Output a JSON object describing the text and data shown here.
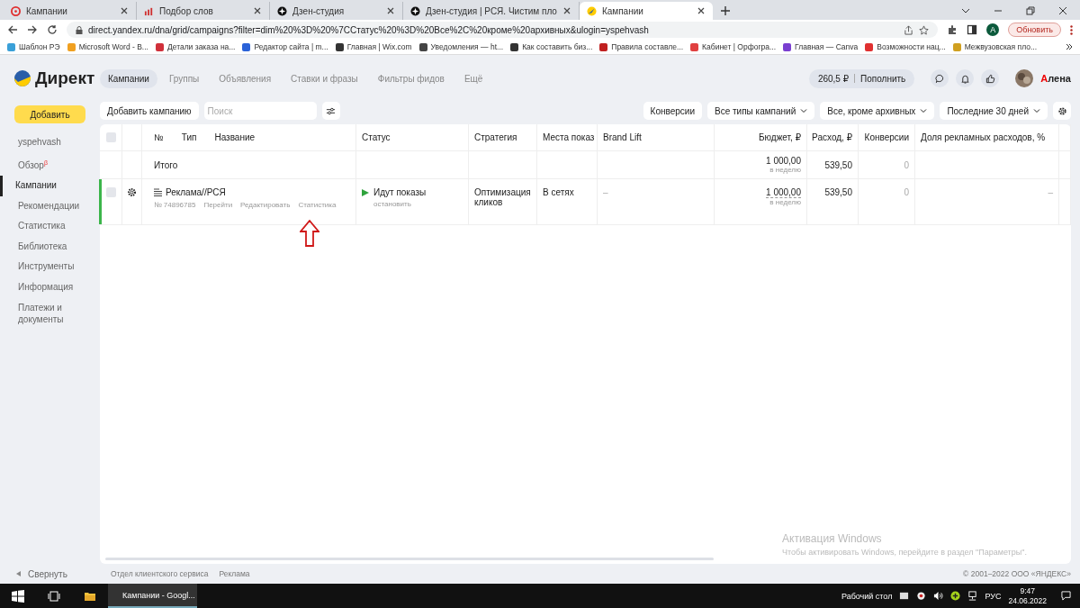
{
  "browser": {
    "tabs": [
      {
        "title": "Кампании",
        "selected": false
      },
      {
        "title": "Подбор слов",
        "selected": false
      },
      {
        "title": "Дзен-студия",
        "selected": false
      },
      {
        "title": "Дзен-студия | РСЯ. Чистим пло",
        "selected": false
      },
      {
        "title": "Кампании",
        "selected": true
      }
    ],
    "address": "direct.yandex.ru/dna/grid/campaigns?filter=dim%20%3D%20%7CСтатус%20%3D%20Все%2C%20кроме%20архивных&ulogin=yspehvash",
    "profile": "A",
    "update_button": "Обновить",
    "bookmarks": [
      "Шаблон РЭ",
      "Microsoft Word - В...",
      "Детали заказа на...",
      "Редактор сайта | m...",
      "Главная | Wix.com",
      "Уведомления — ht...",
      "Как составить биз...",
      "Правила составле...",
      "Кабинет | Орфогра...",
      "Главная — Canva",
      "Возможности нац...",
      "Межвузовская пло..."
    ]
  },
  "header": {
    "logo": "Директ",
    "nav": [
      {
        "label": "Кампании",
        "selected": true
      },
      {
        "label": "Группы",
        "selected": false
      },
      {
        "label": "Объявления",
        "selected": false
      },
      {
        "label": "Ставки и фразы",
        "selected": false
      },
      {
        "label": "Фильтры фидов",
        "selected": false
      },
      {
        "label": "Ещё",
        "selected": false
      }
    ],
    "balance": "260,5 ₽",
    "topup": "Пополнить",
    "user": "Алена"
  },
  "sidebar": {
    "add_button": "Добавить",
    "items": [
      {
        "label": "yspehvash",
        "selected": false
      },
      {
        "label": "Обзор$^{β}$",
        "selected": false
      },
      {
        "label": "Кампании",
        "selected": true
      },
      {
        "label": "Рекомендации",
        "selected": false
      },
      {
        "label": "Статистика",
        "selected": false
      },
      {
        "label": "Библиотека",
        "selected": false
      },
      {
        "label": "Инструменты",
        "selected": false
      },
      {
        "label": "Информация",
        "selected": false
      },
      {
        "label": "Платежи и документы",
        "selected": false
      }
    ],
    "collapse": "Свернуть"
  },
  "toolbar": {
    "add_campaign": "Добавить кампанию",
    "search": {
      "placeholder": "Поиск"
    },
    "filters": [
      {
        "label": "Конверсии",
        "dropdown": false
      },
      {
        "label": "Все типы кампаний",
        "dropdown": true
      },
      {
        "label": "Все, кроме архивных",
        "dropdown": true
      },
      {
        "label": "Последние 30 дней",
        "dropdown": true
      }
    ]
  },
  "table": {
    "all_checked": false,
    "columns": [
      "№",
      "Тип",
      "Название",
      "Статус",
      "Стратегия",
      "Места показ",
      "Brand Lift",
      "Бюджет, ₽",
      "Расход, ₽",
      "Конверсии",
      "Доля рекламных расходов, %"
    ],
    "total": {
      "label": "Итого",
      "budget": "1 000,00",
      "budget_period": "в неделю",
      "expense": "539,50",
      "conversions": "0"
    },
    "rows": [
      {
        "checked": false,
        "active": true,
        "name": "Реклама//РСЯ",
        "number": "№ 74896785",
        "actions": [
          "Перейти",
          "Редактировать",
          "Статистика"
        ],
        "status": "Идут показы",
        "status_action": "остановить",
        "strategy": "Оптимизация кликов",
        "places": "В сетях",
        "brand_lift": "–",
        "budget": "1 000,00",
        "budget_period": "в неделю",
        "expense": "539,50",
        "conversions": "0",
        "share": "–"
      }
    ]
  },
  "activation": {
    "title": "Активация Windows",
    "text": "Чтобы активировать Windows, перейдите в раздел \"Параметры\"."
  },
  "footer": {
    "links": [
      "Отдел клиентского сервиса",
      "Реклама"
    ],
    "copyright": "© 2001–2022 ООО «ЯНДЕКС»"
  },
  "taskbar": {
    "app": "Кампании - Googl...",
    "desktop": "Рабочий стол",
    "lang": "РУС",
    "time": "9:47",
    "date": "24.06.2022"
  }
}
